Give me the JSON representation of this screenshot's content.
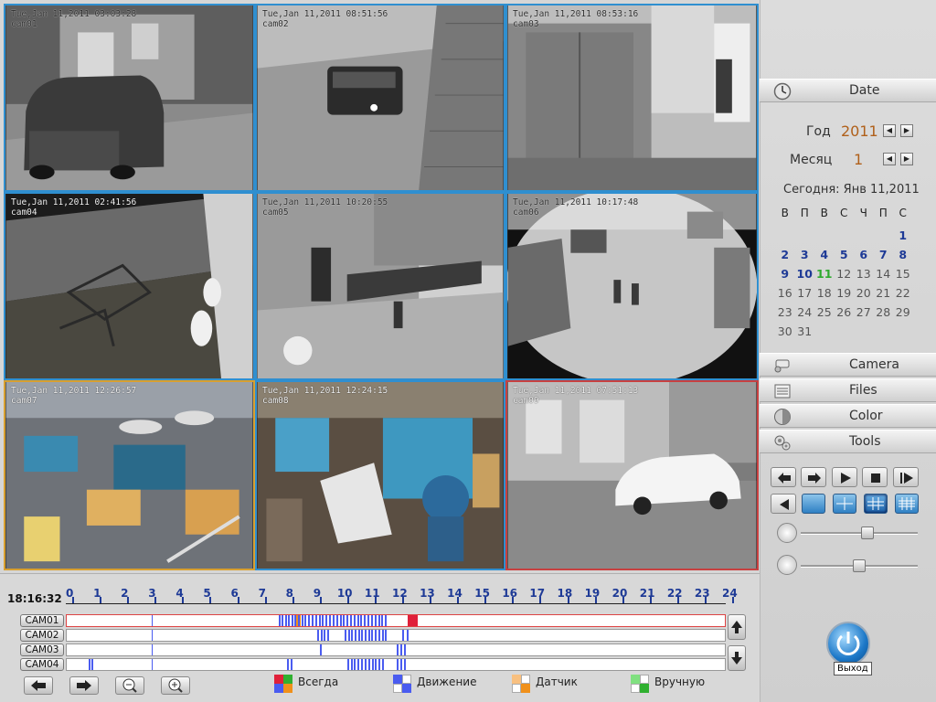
{
  "cameras": [
    {
      "stamp": "Tue,Jan 11,2011 03:03:28",
      "name": "cam01"
    },
    {
      "stamp": "Tue,Jan 11,2011 08:51:56",
      "name": "cam02"
    },
    {
      "stamp": "Tue,Jan 11,2011 08:53:16",
      "name": "cam03"
    },
    {
      "stamp": "Tue,Jan 11,2011 02:41:56",
      "name": "cam04"
    },
    {
      "stamp": "Tue,Jan 11,2011 10:20:55",
      "name": "cam05"
    },
    {
      "stamp": "Tue,Jan 11,2011 10:17:48",
      "name": "cam06"
    },
    {
      "stamp": "Tue,Jan 11,2011 12:26:57",
      "name": "cam07"
    },
    {
      "stamp": "Tue,Jan 11,2011 12:24:15",
      "name": "cam08"
    },
    {
      "stamp": "Tue,Jan 11,2011 07:51:13",
      "name": "cam09"
    }
  ],
  "panel": {
    "date_label": "Date",
    "year_label": "Год",
    "year_value": "2011",
    "month_label": "Месяц",
    "month_value": "1",
    "today_text": "Сегодня: Янв 11,2011",
    "weekdays": [
      "В",
      "П",
      "В",
      "С",
      "Ч",
      "П",
      "С"
    ],
    "weeks": [
      [
        "",
        "",
        "",
        "",
        "",
        "",
        "1"
      ],
      [
        "2",
        "3",
        "4",
        "5",
        "6",
        "7",
        "8"
      ],
      [
        "9",
        "10",
        "11",
        "12",
        "13",
        "14",
        "15"
      ],
      [
        "16",
        "17",
        "18",
        "19",
        "20",
        "21",
        "22"
      ],
      [
        "23",
        "24",
        "25",
        "26",
        "27",
        "28",
        "29"
      ],
      [
        "30",
        "31",
        "",
        "",
        "",
        "",
        ""
      ]
    ],
    "active_days": [
      "1",
      "2",
      "3",
      "4",
      "5",
      "6",
      "7",
      "8",
      "9",
      "10"
    ],
    "today_day": "11",
    "camera_label": "Camera",
    "files_label": "Files",
    "color_label": "Color",
    "tools_label": "Tools",
    "volume_level": 0.58,
    "speed_level": 0.5
  },
  "timeline": {
    "clock": "18:16:32",
    "hours": [
      "0",
      "1",
      "2",
      "3",
      "4",
      "5",
      "6",
      "7",
      "8",
      "9",
      "10",
      "11",
      "12",
      "13",
      "14",
      "15",
      "16",
      "17",
      "18",
      "19",
      "20",
      "21",
      "22",
      "23",
      "24"
    ],
    "cameras": [
      "CAM01",
      "CAM02",
      "CAM03",
      "CAM04"
    ],
    "legend": {
      "always": "Всегда",
      "motion": "Движение",
      "sensor": "Датчик",
      "manual": "Вручную"
    },
    "colors": {
      "motion": "#4a5cf0",
      "sensor": "#f0901a",
      "always": "#e0203a",
      "manual": "#30b030"
    }
  },
  "exit_label": "Выход"
}
